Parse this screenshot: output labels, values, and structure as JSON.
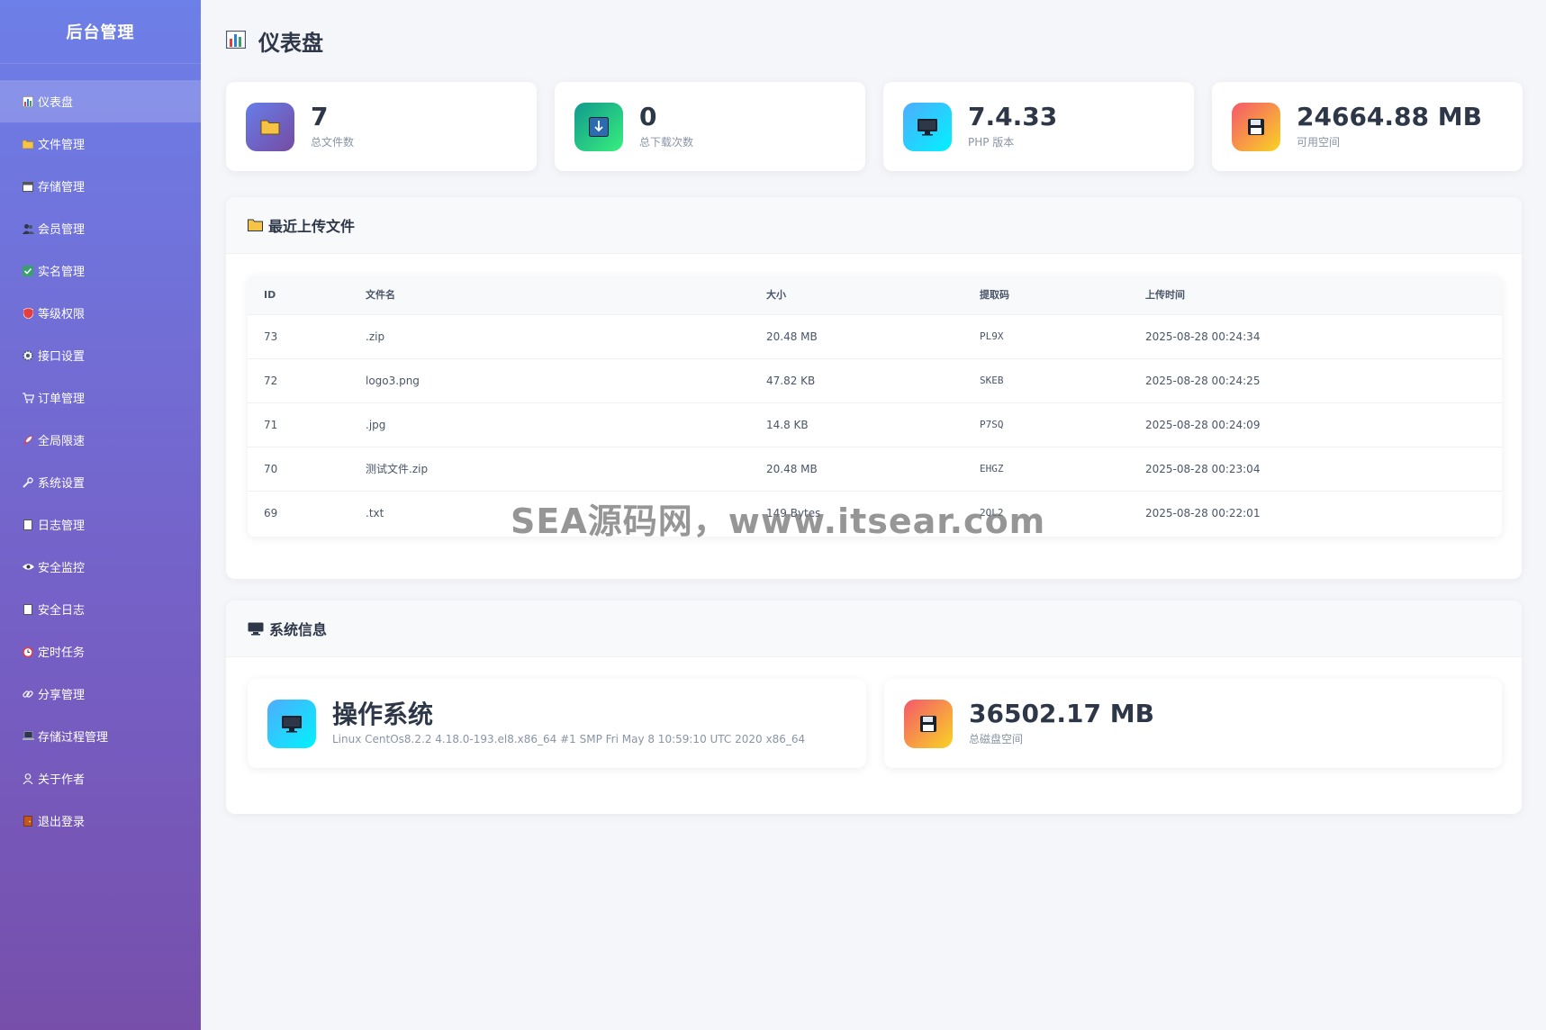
{
  "sidebar": {
    "brand": "后台管理",
    "items": [
      {
        "label": "仪表盘",
        "icon": "bar-chart-icon",
        "active": true
      },
      {
        "label": "文件管理",
        "icon": "folder-icon"
      },
      {
        "label": "存储管理",
        "icon": "calendar-icon"
      },
      {
        "label": "会员管理",
        "icon": "users-icon"
      },
      {
        "label": "实名管理",
        "icon": "check-box-icon"
      },
      {
        "label": "等级权限",
        "icon": "shield-icon"
      },
      {
        "label": "接口设置",
        "icon": "gear-icon"
      },
      {
        "label": "订单管理",
        "icon": "cart-icon"
      },
      {
        "label": "全局限速",
        "icon": "rocket-icon"
      },
      {
        "label": "系统设置",
        "icon": "wrench-icon"
      },
      {
        "label": "日志管理",
        "icon": "document-icon"
      },
      {
        "label": "安全监控",
        "icon": "eye-icon"
      },
      {
        "label": "安全日志",
        "icon": "document-icon"
      },
      {
        "label": "定时任务",
        "icon": "alarm-clock-icon"
      },
      {
        "label": "分享管理",
        "icon": "link-icon"
      },
      {
        "label": "存储过程管理",
        "icon": "laptop-icon"
      },
      {
        "label": "关于作者",
        "icon": "user-icon"
      },
      {
        "label": "退出登录",
        "icon": "door-icon"
      }
    ]
  },
  "page": {
    "title": "仪表盘"
  },
  "stats": [
    {
      "value": "7",
      "label": "总文件数",
      "icon": "folder-icon"
    },
    {
      "value": "0",
      "label": "总下载次数",
      "icon": "download-icon"
    },
    {
      "value": "7.4.33",
      "label": "PHP 版本",
      "icon": "monitor-icon"
    },
    {
      "value": "24664.88 MB",
      "label": "可用空间",
      "icon": "floppy-disk-icon"
    }
  ],
  "recent_files": {
    "title": "最近上传文件",
    "columns": [
      "ID",
      "文件名",
      "大小",
      "提取码",
      "上传时间"
    ],
    "rows": [
      {
        "id": "73",
        "name": ".zip",
        "size": "20.48 MB",
        "code": "PL9X",
        "time": "2025-08-28 00:24:34"
      },
      {
        "id": "72",
        "name": "logo3.png",
        "size": "47.82 KB",
        "code": "SKEB",
        "time": "2025-08-28 00:24:25"
      },
      {
        "id": "71",
        "name": ".jpg",
        "size": "14.8 KB",
        "code": "P7SQ",
        "time": "2025-08-28 00:24:09"
      },
      {
        "id": "70",
        "name": "测试文件.zip",
        "size": "20.48 MB",
        "code": "EHGZ",
        "time": "2025-08-28 00:23:04"
      },
      {
        "id": "69",
        "name": ".txt",
        "size": "149 Bytes",
        "code": "2QL2",
        "time": "2025-08-28 00:22:01"
      }
    ]
  },
  "system_info": {
    "title": "系统信息",
    "os": {
      "title": "操作系统",
      "detail": "Linux CentOs8.2.2 4.18.0-193.el8.x86_64 #1 SMP Fri May 8 10:59:10 UTC 2020 x86_64"
    },
    "disk": {
      "value": "36502.17 MB",
      "label": "总磁盘空间"
    }
  },
  "watermark": "SEA源码网，www.itsear.com",
  "colors": {
    "accent": "#667eea",
    "sidebar_end": "#764ba2"
  }
}
